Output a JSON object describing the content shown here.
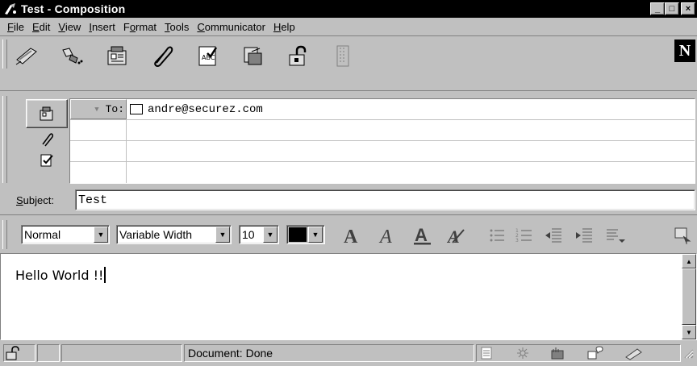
{
  "window": {
    "title": "Test - Composition",
    "controls": [
      "_",
      "□",
      "×"
    ]
  },
  "menu": [
    {
      "label": "File",
      "key": "F",
      "rest": "ile"
    },
    {
      "label": "Edit",
      "key": "E",
      "rest": "dit"
    },
    {
      "label": "View",
      "key": "V",
      "rest": "iew"
    },
    {
      "label": "Insert",
      "key": "I",
      "rest": "nsert"
    },
    {
      "label": "Format",
      "pre": "F",
      "key": "o",
      "rest": "rmat"
    },
    {
      "label": "Tools",
      "key": "T",
      "rest": "ools"
    },
    {
      "label": "Communicator",
      "key": "C",
      "rest": "ommunicator"
    },
    {
      "label": "Help",
      "key": "H",
      "rest": "elp"
    }
  ],
  "toolbar": {
    "icons": [
      "send-icon",
      "quote-icon",
      "address-icon",
      "attach-icon",
      "spelling-icon",
      "save-icon",
      "security-icon",
      "stop-icon"
    ],
    "logo": "N"
  },
  "address": {
    "type_label": "To:",
    "recipient": "andre@securez.com"
  },
  "subject": {
    "label_key": "S",
    "label_rest": "ubject:",
    "value": "Test"
  },
  "format": {
    "paragraph_style": "Normal",
    "font": "Variable Width",
    "size": "10",
    "color": "#000000"
  },
  "message": {
    "body": "Hello World !!"
  },
  "status": {
    "text": "Document: Done"
  }
}
